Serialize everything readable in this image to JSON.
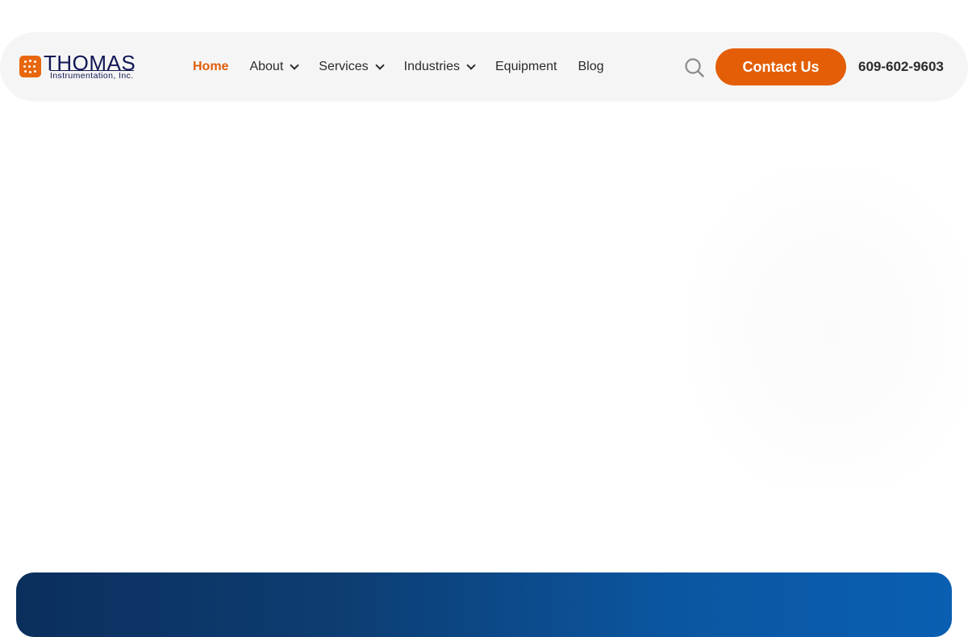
{
  "brand": {
    "name": "THOMAS",
    "subtitle": "Instrumentation, Inc.",
    "accent_color": "#e35e06",
    "text_color": "#121856"
  },
  "nav": {
    "items": [
      {
        "label": "Home",
        "active": true,
        "dropdown": false
      },
      {
        "label": "About",
        "active": false,
        "dropdown": true
      },
      {
        "label": "Services",
        "active": false,
        "dropdown": true
      },
      {
        "label": "Industries",
        "active": false,
        "dropdown": true
      },
      {
        "label": "Equipment",
        "active": false,
        "dropdown": false
      },
      {
        "label": "Blog",
        "active": false,
        "dropdown": false
      }
    ]
  },
  "header": {
    "search_icon": "search-icon",
    "contact_label": "Contact Us",
    "phone": "609-602-9603"
  },
  "banner": {
    "gradient_start": "#0b2f5d",
    "gradient_end": "#0a5fb2"
  }
}
